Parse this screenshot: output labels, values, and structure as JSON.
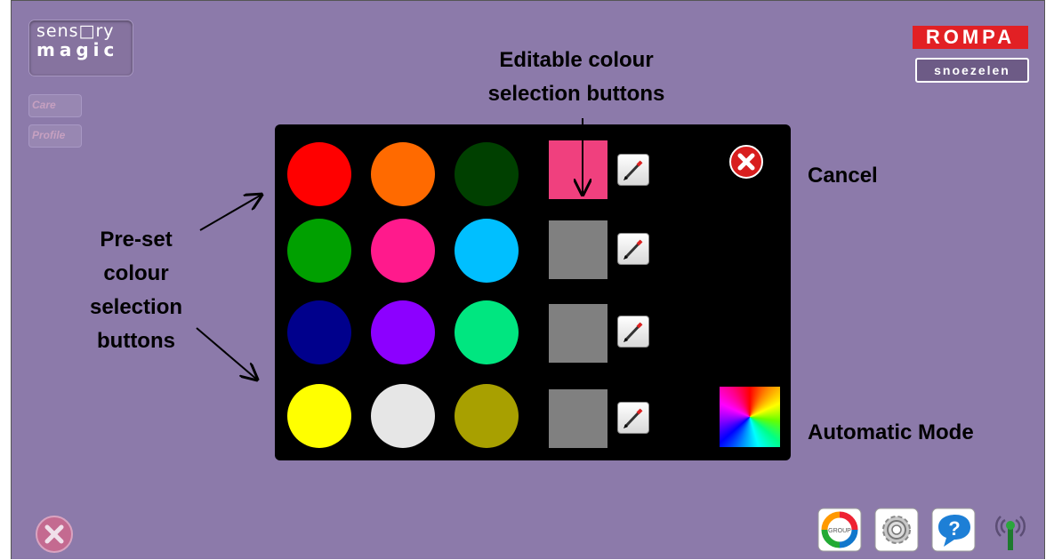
{
  "header": {
    "logo_line1": "sens□ry",
    "logo_line2": "magic",
    "care_label": "Care",
    "profile_label": "Profile",
    "rompa_top": "ROMPA",
    "rompa_bottom": "snoezelen"
  },
  "preset_colours": [
    [
      "#ff0000",
      "#ff6a00",
      "#004000"
    ],
    [
      "#00a000",
      "#ff1a8c",
      "#00bfff"
    ],
    [
      "#00008c",
      "#8c00ff",
      "#00e680"
    ],
    [
      "#ffff00",
      "#e6e6e6",
      "#a8a000"
    ]
  ],
  "editable_colours": [
    "#f0407e",
    "#808080",
    "#808080",
    "#808080"
  ],
  "icons": {
    "edit": "pencil-edit-icon",
    "cancel": "cancel-x-icon",
    "automatic": "colour-wheel-icon",
    "group": "group-cycle-icon",
    "settings": "gear-icon",
    "help": "help-question-icon",
    "wireless": "wireless-signal-icon",
    "close": "close-x-icon"
  },
  "annotations": {
    "editable_line1": "Editable colour",
    "editable_line2": "selection buttons",
    "cancel": "Cancel",
    "automatic_mode": "Automatic Mode",
    "preset_line1": "Pre-set",
    "preset_line2": "colour",
    "preset_line3": "selection",
    "preset_line4": "buttons"
  },
  "bottom_bar": {
    "group_label": "GROUP"
  }
}
